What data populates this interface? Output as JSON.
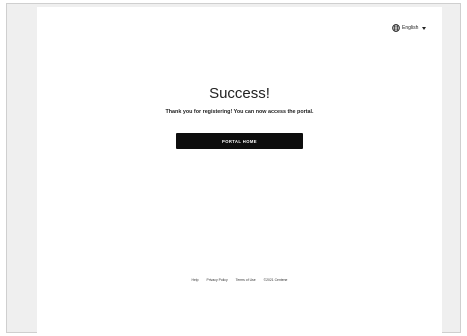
{
  "language": {
    "label": "English",
    "icon": "globe-icon",
    "dropdown_icon": "chevron-down-icon"
  },
  "main": {
    "title": "Success!",
    "message": "Thank you for registering! You can now access the portal.",
    "button_label": "PORTAL HOME"
  },
  "footer": {
    "links": [
      "Help",
      "Privacy Policy",
      "Terms of Use"
    ],
    "copyright": "©2021 Centene"
  },
  "colors": {
    "button_bg": "#0d0d0d",
    "page_bg": "#efefef",
    "card_bg": "#ffffff"
  }
}
